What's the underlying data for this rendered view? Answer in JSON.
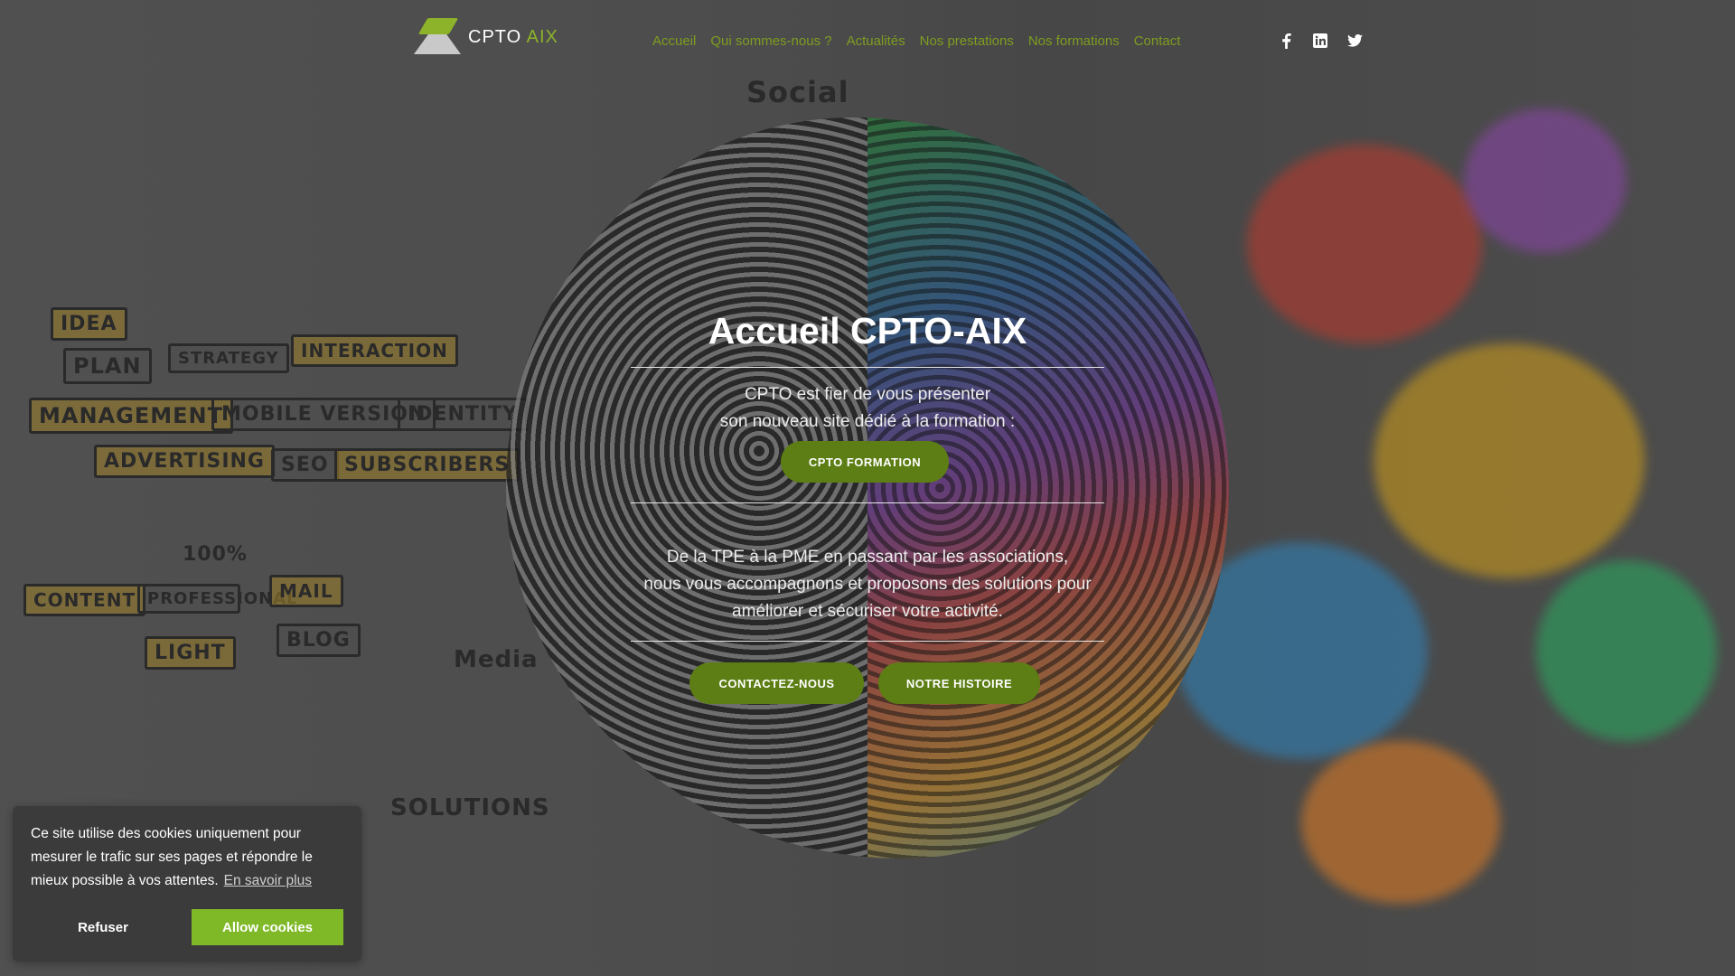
{
  "brand": {
    "name_part1": "CPTO",
    "name_part2": "AIX"
  },
  "nav": {
    "items": [
      {
        "label": "Accueil"
      },
      {
        "label": "Qui sommes-nous ?"
      },
      {
        "label": "Actualités"
      },
      {
        "label": "Nos prestations"
      },
      {
        "label": "Nos formations"
      },
      {
        "label": "Contact"
      }
    ]
  },
  "social": {
    "icons": [
      "facebook-icon",
      "linkedin-icon",
      "twitter-icon"
    ]
  },
  "hero": {
    "title": "Accueil CPTO-AIX",
    "intro_line1": "CPTO est fier de vous présenter",
    "intro_line2": "son nouveau site dédié à la formation :",
    "formation_button": "CPTO FORMATION",
    "body_line1": "De la TPE à la PME en passant par les associations,",
    "body_line2": "nous vous accompagnons et proposons des solutions pour",
    "body_line3": "améliorer et sécuriser votre activité.",
    "contact_button": "CONTACTEZ-NOUS",
    "story_button": "NOTRE HISTOIRE"
  },
  "background_words": [
    "Social",
    "IDEA",
    "PLAN",
    "STRATEGY",
    "INTERACTION",
    "MANAGEMENT",
    "MOBILE VERSION",
    "IDENTITY",
    "ADVERTISING",
    "SEO",
    "SUBSCRIBERS",
    "CONTENT",
    "PROFESSIONAL",
    "MAIL",
    "BLOG",
    "LIGHT",
    "Media",
    "SOLUTIONS",
    "100%"
  ],
  "cookie": {
    "message": "Ce site utilise des cookies uniquement pour mesurer le trafic sur ses pages et répondre le mieux possible à vos attentes.",
    "learn_more": "En savoir plus",
    "refuse": "Refuser",
    "allow": "Allow cookies"
  },
  "colors": {
    "accent": "#7e9d1f",
    "button": "#5c7e14",
    "allow_button": "#7fb928",
    "cookie_bg": "#3b3b3b"
  }
}
